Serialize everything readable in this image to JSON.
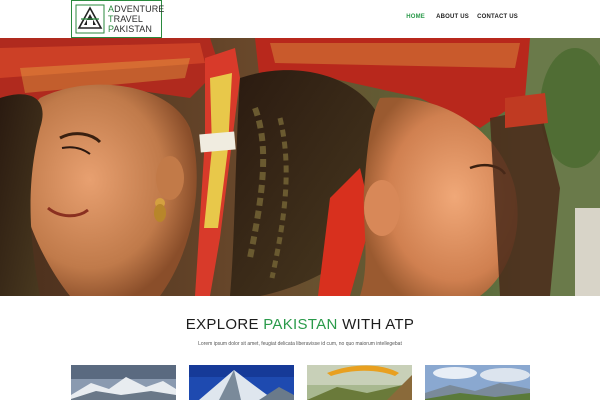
{
  "brand": {
    "line1": "ADVENTURE",
    "line2": "TRAVEL",
    "line3": "PAKISTAN",
    "accent_color": "#2a8a3e"
  },
  "nav": {
    "items": [
      {
        "label": "HOME",
        "active": true
      },
      {
        "label": "ABOUT US",
        "active": false
      },
      {
        "label": "CONTACT US",
        "active": false
      }
    ]
  },
  "section": {
    "title_pre": "EXPLORE ",
    "title_accent": "PAKISTAN",
    "title_post": " WITH ATP",
    "subtitle": "Lorem ipsum dolor sit amet, feugiat delicata liberavisse id cum, no quo maiorum intellegebat"
  },
  "thumbnails": [
    {
      "name": "mountain-range-photo"
    },
    {
      "name": "snow-peak-photo"
    },
    {
      "name": "paraglider-photo"
    },
    {
      "name": "valley-landscape-photo"
    }
  ]
}
